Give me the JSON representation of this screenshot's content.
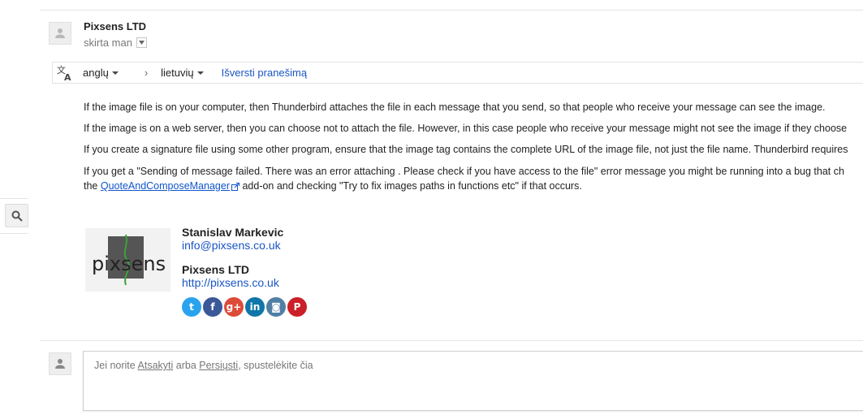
{
  "sender": {
    "name": "Pixsens LTD",
    "recipient_label": "skirta man"
  },
  "translate": {
    "icon": "translate-icon",
    "source_lang": "anglų",
    "target_lang": "lietuvių",
    "action": "Išversti pranešimą"
  },
  "body": {
    "p1": "If the image file is on your computer, then Thunderbird attaches the file in each message that you send, so that people who receive your message can see the image.",
    "p2": "If the image is on a web server, then you can choose not to attach the file. However, in this case people who receive your message might not see the image if they choose",
    "p3": "If you create a signature file using some other program, ensure that the image tag contains the complete URL of the image file, not just the file name. Thunderbird requires",
    "p4_line1": "If you get a \"Sending of message failed. There was an error attaching . Please check if you have access to the file\" error message you might be running into a bug that ch",
    "p4_prefix": "the ",
    "p4_link": "QuoteAndComposeManager",
    "p4_suffix": " add-on and checking \"Try to fix images paths in functions etc\" if that occurs."
  },
  "signature": {
    "logo_text": "pixsens",
    "person": "Stanislav Markevic",
    "email": "info@pixsens.co.uk",
    "company": "Pixsens LTD",
    "website": "http://pixsens.co.uk",
    "social": [
      {
        "name": "twitter-icon",
        "glyph": "t",
        "color": "#2aa3ef"
      },
      {
        "name": "facebook-icon",
        "glyph": "f",
        "color": "#3b5998"
      },
      {
        "name": "googleplus-icon",
        "glyph": "g+",
        "color": "#dd4b39"
      },
      {
        "name": "linkedin-icon",
        "glyph": "in",
        "color": "#0e76a8"
      },
      {
        "name": "instagram-icon",
        "glyph": "◙",
        "color": "#517fa4"
      },
      {
        "name": "pinterest-icon",
        "glyph": "P",
        "color": "#cb2027"
      }
    ]
  },
  "reply": {
    "prefix": "Jei norite ",
    "reply_link": "Atsakyti",
    "middle": " arba ",
    "forward_link": "Persiųsti",
    "suffix": ", spustelėkite čia"
  }
}
